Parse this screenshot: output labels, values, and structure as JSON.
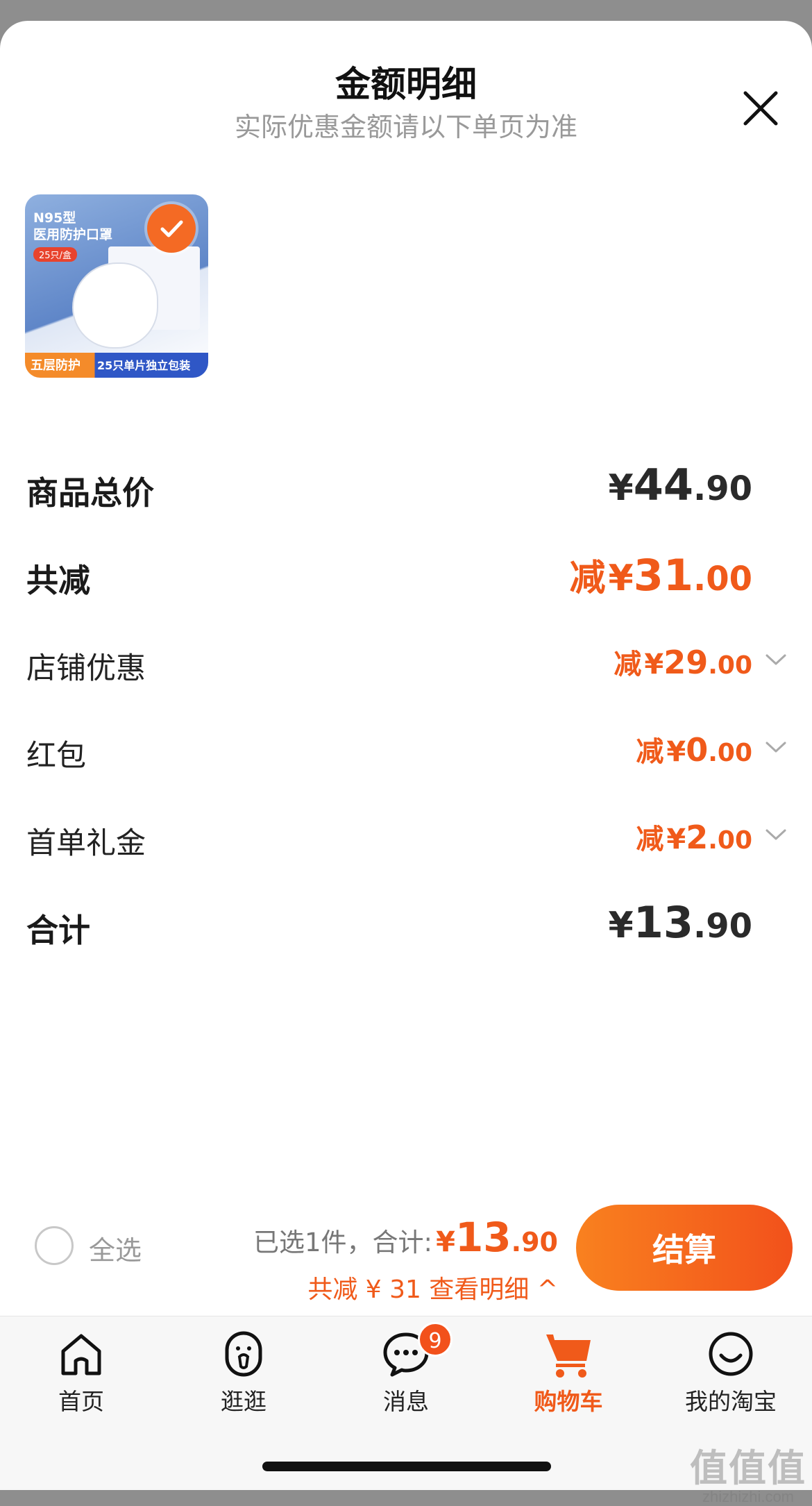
{
  "sheet": {
    "title": "金额明细",
    "subtitle": "实际优惠金额请以下单页为准",
    "close_icon": "close-icon"
  },
  "product": {
    "thumb_title": "N95型\n医用防护口罩",
    "thumb_tag": "25只/盒",
    "thumb_bar_left": "五层防护",
    "thumb_bar_right": "25只单片独立包装",
    "selected": true
  },
  "breakdown": {
    "total_price": {
      "label": "商品总价",
      "currency": "¥",
      "int": "44",
      "dec": ".90"
    },
    "total_discount": {
      "label": "共减",
      "prefix": "减",
      "currency": "¥",
      "int": "31",
      "dec": ".00"
    },
    "shop_discount": {
      "label": "店铺优惠",
      "prefix": "减",
      "currency": "¥",
      "int": "29",
      "dec": ".00"
    },
    "red_packet": {
      "label": "红包",
      "prefix": "减",
      "currency": "¥",
      "int": "0",
      "dec": ".00"
    },
    "first_order_gift": {
      "label": "首单礼金",
      "prefix": "减",
      "currency": "¥",
      "int": "2",
      "dec": ".00"
    },
    "sum": {
      "label": "合计",
      "currency": "¥",
      "int": "13",
      "dec": ".90"
    }
  },
  "footer": {
    "select_all": "全选",
    "summary_label": "已选1件，合计:",
    "currency": "¥",
    "total_int": "13",
    "total_dec": ".90",
    "detail_link": "共减 ¥ 31 查看明细 ^",
    "checkout": "结算"
  },
  "tabbar": {
    "items": [
      {
        "label": "首页",
        "icon": "home-icon"
      },
      {
        "label": "逛逛",
        "icon": "discover-icon"
      },
      {
        "label": "消息",
        "icon": "message-icon",
        "badge": "9"
      },
      {
        "label": "购物车",
        "icon": "cart-icon",
        "active": true
      },
      {
        "label": "我的淘宝",
        "icon": "smile-icon"
      }
    ]
  },
  "colors": {
    "accent": "#f05a1a",
    "checkout_from": "#f9811f",
    "checkout_to": "#f2511b"
  },
  "watermark": {
    "big": "值值值",
    "small": "zhizhizhi.com"
  }
}
